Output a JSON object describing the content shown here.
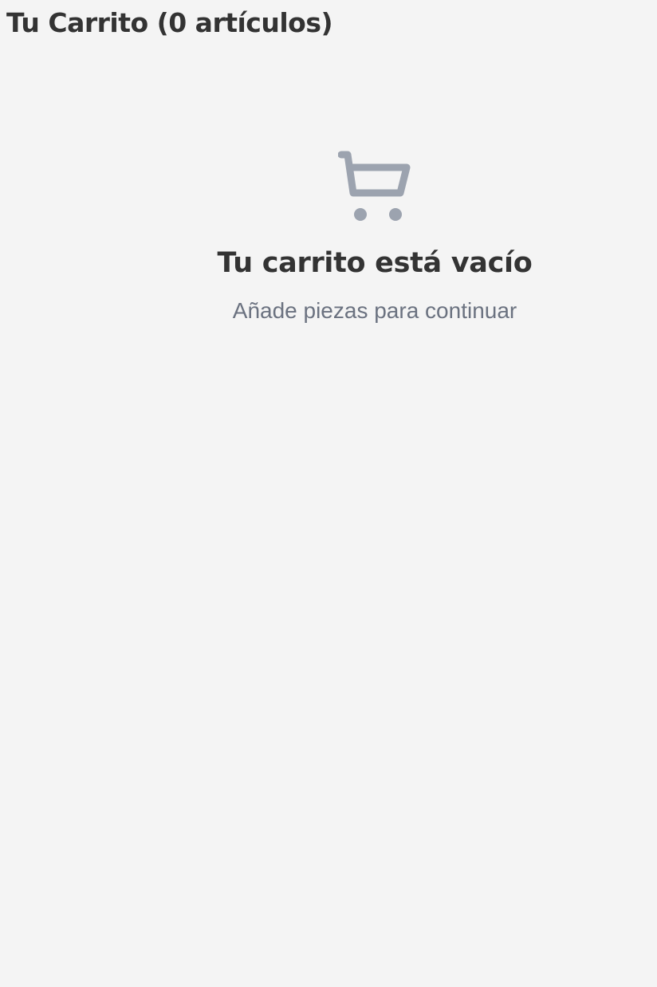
{
  "header": {
    "title": "Tu Carrito (0 artículos)"
  },
  "empty_state": {
    "icon": "cart-icon",
    "icon_color": "#9ca3af",
    "heading": "Tu carrito está vacío",
    "message": "Añade piezas para continuar"
  },
  "colors": {
    "background": "#f4f4f4",
    "title_text": "#333333",
    "muted_text": "#6b7280"
  }
}
